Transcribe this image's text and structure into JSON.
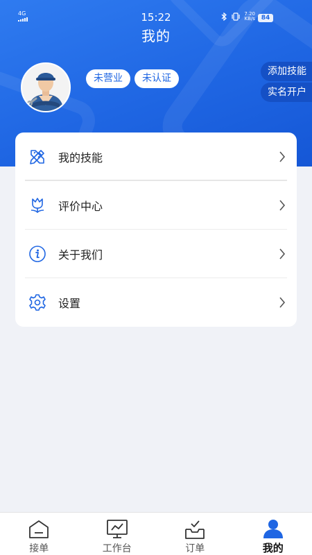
{
  "status_bar": {
    "network": "4G",
    "time": "15:22",
    "speed_value": "7.20",
    "speed_unit": "KB/s",
    "battery": "84"
  },
  "page": {
    "title": "我的"
  },
  "profile": {
    "tags": [
      "未营业",
      "未认证"
    ],
    "actions": [
      "添加技能",
      "实名开户"
    ]
  },
  "menu": [
    {
      "icon": "pencil-ruler-icon",
      "label": "我的技能"
    },
    {
      "icon": "tulip-icon",
      "label": "评价中心"
    },
    {
      "icon": "info-circle-icon",
      "label": "关于我们"
    },
    {
      "icon": "gear-icon",
      "label": "设置"
    }
  ],
  "bottom_nav": [
    {
      "icon": "home-icon",
      "label": "接单",
      "active": false
    },
    {
      "icon": "monitor-icon",
      "label": "工作台",
      "active": false
    },
    {
      "icon": "inbox-check-icon",
      "label": "订单",
      "active": false
    },
    {
      "icon": "user-icon",
      "label": "我的",
      "active": true
    }
  ],
  "colors": {
    "accent": "#1f66e3",
    "header_dark": "#1550c5",
    "page_bg": "#f0f2f7",
    "active_nav": "#1f66e3"
  }
}
